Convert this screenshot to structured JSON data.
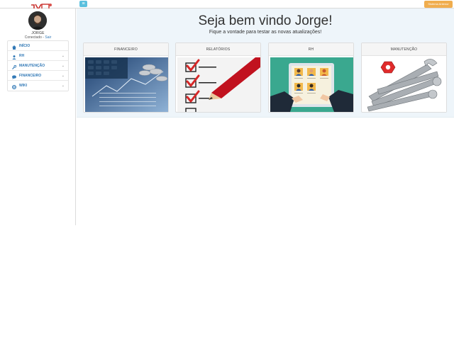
{
  "header": {
    "old_system_label": "Sistema Antenor",
    "toggle_label": "≡"
  },
  "user": {
    "name": "JORGE",
    "status": "Conectado - ",
    "logout_label": "Sair"
  },
  "sidebar": {
    "items": [
      {
        "label": "INÍCIO",
        "icon": "home-icon",
        "has_chevron": false
      },
      {
        "label": "RH",
        "icon": "user-icon",
        "has_chevron": true
      },
      {
        "label": "MANUTENÇÃO",
        "icon": "wrench-icon",
        "has_chevron": true
      },
      {
        "label": "FINANCEIRO",
        "icon": "comment-icon",
        "has_chevron": true
      },
      {
        "label": "WIKI",
        "icon": "globe-icon",
        "has_chevron": true
      }
    ],
    "chevron": "⌄"
  },
  "main": {
    "title": "Seja bem vindo Jorge!",
    "subtitle": "Fique a vontade para testar as novas atualizações!",
    "cards": [
      {
        "label": "FINANCEIRO",
        "image": "finance-calculator-image"
      },
      {
        "label": "RELATÓRIOS",
        "image": "checklist-image"
      },
      {
        "label": "RH",
        "image": "hr-profiles-image"
      },
      {
        "label": "MANUTENÇÃO",
        "image": "wrenches-image"
      }
    ]
  },
  "colors": {
    "accent": "#337ab7",
    "warning": "#f0ad4e",
    "info": "#5bc0de",
    "panel": "#eef5fa"
  }
}
